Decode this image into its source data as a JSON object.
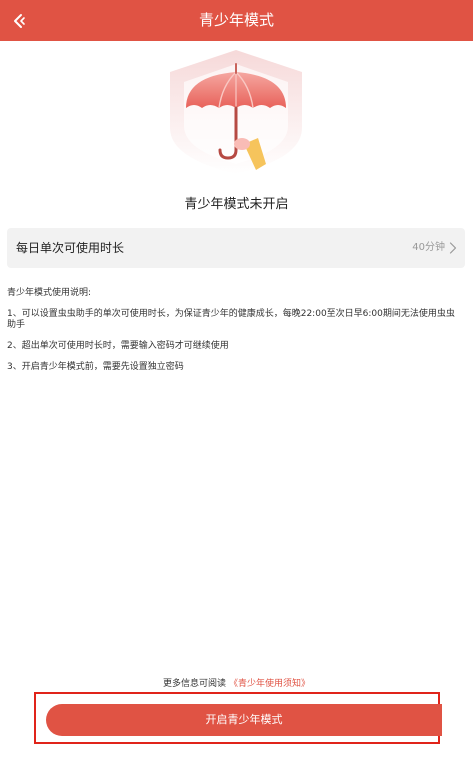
{
  "header": {
    "title": "青少年模式",
    "back_icon": "back-arrow-icon"
  },
  "hero": {
    "icon": "umbrella-shield-icon"
  },
  "status": {
    "text": "青少年模式未开启"
  },
  "setting": {
    "label": "每日单次可使用时长",
    "value": "40分钟",
    "chevron_icon": "chevron-right-icon"
  },
  "description": {
    "title": "青少年模式使用说明:",
    "items": [
      "1、可以设置虫虫助手的单次可使用时长，为保证青少年的健康成长，每晚22:00至次日早6:00期间无法使用虫虫助手",
      "2、超出单次可使用时长时，需要输入密码才可继续使用",
      "3、开启青少年模式前，需要先设置独立密码"
    ]
  },
  "more_info": {
    "prefix": "更多信息可阅读",
    "link": "《青少年使用须知》"
  },
  "cta": {
    "label": "开启青少年模式"
  },
  "colors": {
    "accent": "#e05344",
    "highlight_border": "#e0241a"
  }
}
